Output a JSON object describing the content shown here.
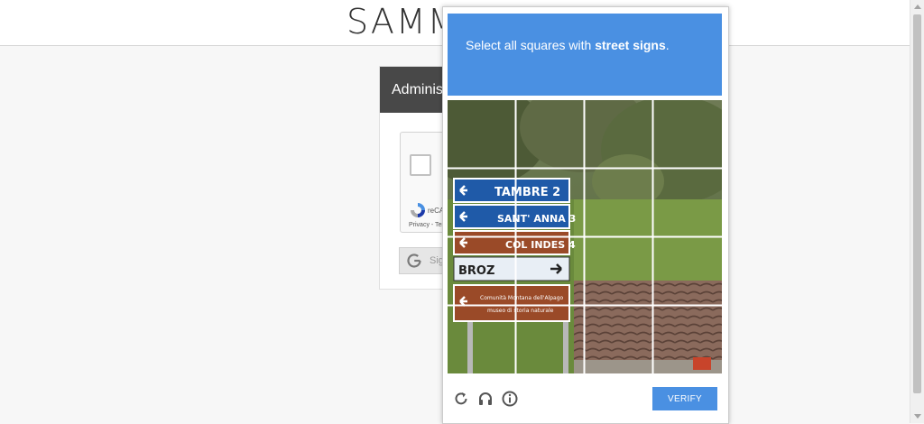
{
  "page": {
    "brand": "SAMM",
    "card_title": "Adminis",
    "recaptcha_brand": "reCA",
    "recaptcha_links": "Privacy - Term",
    "google_signin_label": "Sig"
  },
  "captcha": {
    "instruction_prefix": "Select all squares with ",
    "instruction_target": "street signs",
    "instruction_suffix": ".",
    "verify_label": "VERIFY",
    "footer_icons": [
      "reload-icon",
      "audio-icon",
      "info-icon"
    ],
    "grid_size": 4,
    "accent_color": "#4a90e2"
  },
  "signs": [
    "TAMBRE 2",
    "SANT' ANNA 3",
    "COL INDES 4",
    "BROZ",
    "Comunità Montana dell'Alpago",
    "museo di storia naturale"
  ]
}
